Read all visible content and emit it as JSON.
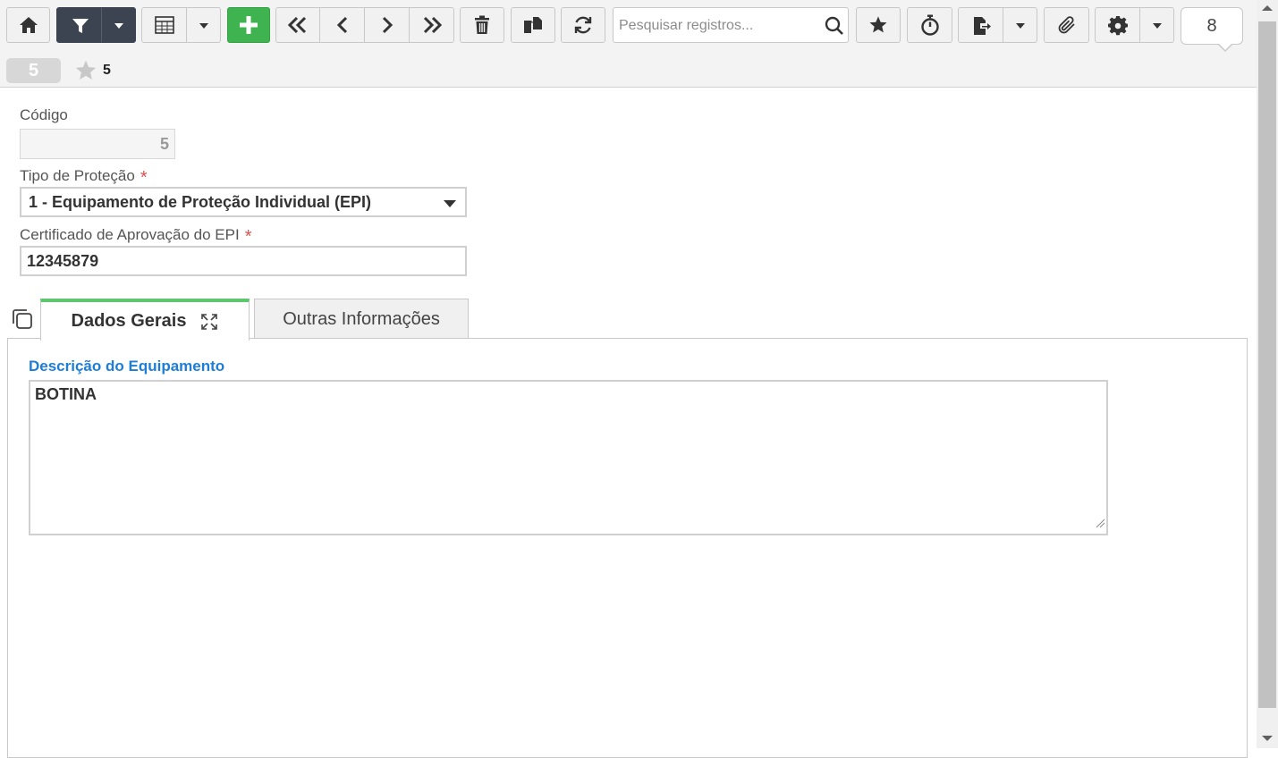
{
  "toolbar": {
    "search_placeholder": "Pesquisar registros...",
    "page_counter": "8",
    "buttons": [
      {
        "name": "home-icon"
      },
      {
        "name": "filter-icon"
      },
      {
        "name": "table-icon"
      },
      {
        "name": "plus-icon"
      },
      {
        "name": "first-record-icon"
      },
      {
        "name": "previous-record-icon"
      },
      {
        "name": "next-record-icon"
      },
      {
        "name": "last-record-icon"
      },
      {
        "name": "trash-icon"
      },
      {
        "name": "copy-icon"
      },
      {
        "name": "refresh-icon"
      },
      {
        "name": "star-icon"
      },
      {
        "name": "stopwatch-icon"
      },
      {
        "name": "export-icon"
      },
      {
        "name": "paperclip-icon"
      },
      {
        "name": "gear-icon"
      }
    ]
  },
  "record_bar": {
    "record_id": "5",
    "favorite_count": "5"
  },
  "form": {
    "codigo": {
      "label": "Código",
      "value": "5"
    },
    "tipo_protecao": {
      "label": "Tipo de Proteção",
      "required_mark": "*",
      "value": "1 - Equipamento de Proteção Individual (EPI)"
    },
    "certificado": {
      "label": "Certificado de Aprovação do EPI",
      "required_mark": "*",
      "value": "12345879"
    }
  },
  "tabs": [
    {
      "label": "Dados Gerais",
      "active": true
    },
    {
      "label": "Outras Informações",
      "active": false
    }
  ],
  "dados_gerais": {
    "descricao_label": "Descrição do Equipamento",
    "descricao_value": "BOTINA"
  },
  "colors": {
    "accent_green": "#3fb34f",
    "tab_active_border": "#5cc76b",
    "label_blue": "#1e7ed6",
    "required_red": "#d9534f",
    "dark_button": "#3d4451"
  }
}
